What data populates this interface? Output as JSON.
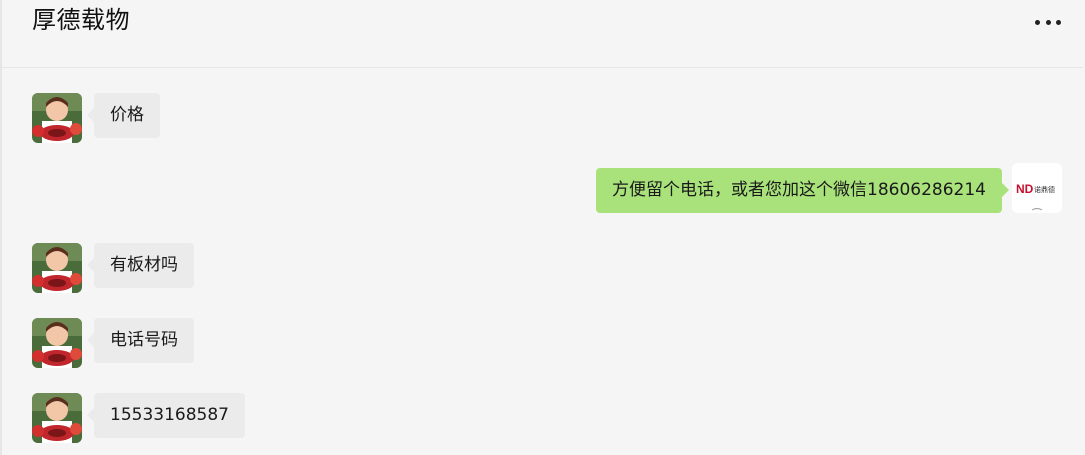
{
  "chat": {
    "title": "厚德载物",
    "more_icon": "more-horizontal-icon"
  },
  "messages": [
    {
      "sender": "contact",
      "text": "价格"
    },
    {
      "sender": "self",
      "text": "方便留个电话，或者您加这个微信18606286214"
    },
    {
      "sender": "contact",
      "text": "有板材吗"
    },
    {
      "sender": "contact",
      "text": "电话号码"
    },
    {
      "sender": "contact",
      "text": "15533168587"
    }
  ],
  "colors": {
    "incoming_bubble": "#ebebeb",
    "outgoing_bubble": "#a9e17b",
    "background": "#f5f5f5"
  },
  "self_avatar": {
    "logo_text": "ND",
    "logo_subtext": "诺鼎德"
  }
}
